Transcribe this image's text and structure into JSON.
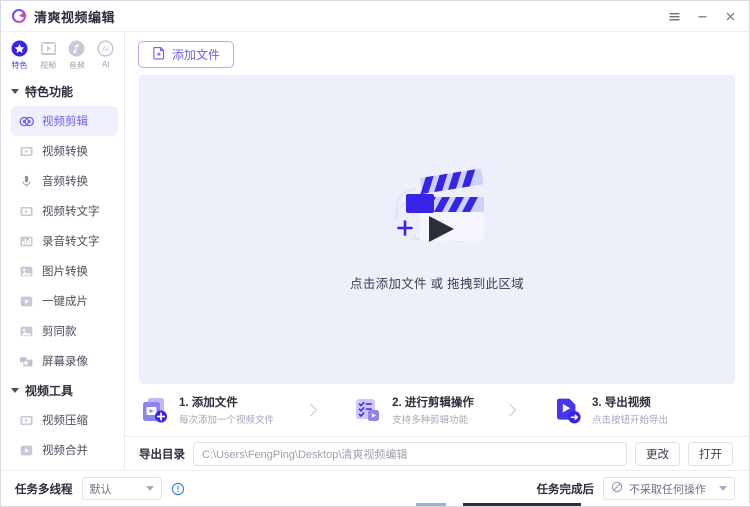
{
  "window": {
    "title": "清爽视频编辑",
    "logo_icon": "app-logo-circle-icon",
    "controls": {
      "menu_label": "≡",
      "minimize_label": "—",
      "close_label": "✕"
    }
  },
  "sidebar": {
    "categories": [
      {
        "label": "特色",
        "icon": "star-badge-icon",
        "active": true
      },
      {
        "label": "视频",
        "icon": "film-strip-icon",
        "active": false
      },
      {
        "label": "音频",
        "icon": "music-note-icon",
        "active": false
      },
      {
        "label": "AI",
        "icon": "ai-badge-icon",
        "active": false
      }
    ],
    "groups": [
      {
        "title": "特色功能",
        "caret_icon": "caret-down-icon",
        "items": [
          {
            "label": "视频剪辑",
            "icon": "video-edit-icon",
            "active": true
          },
          {
            "label": "视频转换",
            "icon": "video-convert-icon",
            "active": false
          },
          {
            "label": "音频转换",
            "icon": "microphone-icon",
            "active": false
          },
          {
            "label": "视频转文字",
            "icon": "video-to-text-icon",
            "active": false
          },
          {
            "label": "录音转文字",
            "icon": "audio-to-text-icon",
            "active": false
          },
          {
            "label": "图片转换",
            "icon": "image-convert-icon",
            "active": false
          },
          {
            "label": "一键成片",
            "icon": "one-click-movie-icon",
            "active": false
          },
          {
            "label": "剪同款",
            "icon": "template-edit-icon",
            "active": false
          },
          {
            "label": "屏幕录像",
            "icon": "screen-record-icon",
            "active": false
          }
        ]
      },
      {
        "title": "视频工具",
        "caret_icon": "caret-down-icon",
        "items": [
          {
            "label": "视频压缩",
            "icon": "video-compress-icon",
            "active": false
          },
          {
            "label": "视频合并",
            "icon": "video-merge-icon",
            "active": false
          }
        ]
      }
    ]
  },
  "toolbar": {
    "add_file_label": "添加文件",
    "add_file_icon": "add-document-icon"
  },
  "dropzone": {
    "hint": "点击添加文件 或 拖拽到此区域",
    "illustration_icon": "clapperboard-play-plus-icon",
    "background": "#edeffa"
  },
  "steps": [
    {
      "title": "1. 添加文件",
      "subtitle": "每次添加一个视频文件",
      "icon": "file-add-icon"
    },
    {
      "title": "2. 进行剪辑操作",
      "subtitle": "支持多种剪辑功能",
      "icon": "checklist-play-icon"
    },
    {
      "title": "3. 导出视频",
      "subtitle": "点击按钮开始导出",
      "icon": "export-arrow-icon"
    }
  ],
  "step_arrow_icon": "chevron-right-icon",
  "export": {
    "label": "导出目录",
    "path_value": "C:\\Users\\FengPing\\Desktop\\清爽视频编辑",
    "path_placeholder": "C:\\Users\\FengPing\\Desktop\\清爽视频编辑",
    "change_label": "更改",
    "open_label": "打开"
  },
  "status": {
    "thread_label": "任务多线程",
    "thread_value": "默认",
    "info_icon": "info-circle-icon",
    "after_task_label": "任务完成后",
    "after_task_value": "不采取任何操作",
    "after_task_icon": "no-action-icon",
    "chevron_icon": "chevron-down-icon"
  },
  "colors": {
    "accent": "#6c5ff5",
    "accent_deep": "#3823e8",
    "panel_bg": "#edeffa",
    "text": "#2b2f3a",
    "muted": "#a2a7b4"
  }
}
